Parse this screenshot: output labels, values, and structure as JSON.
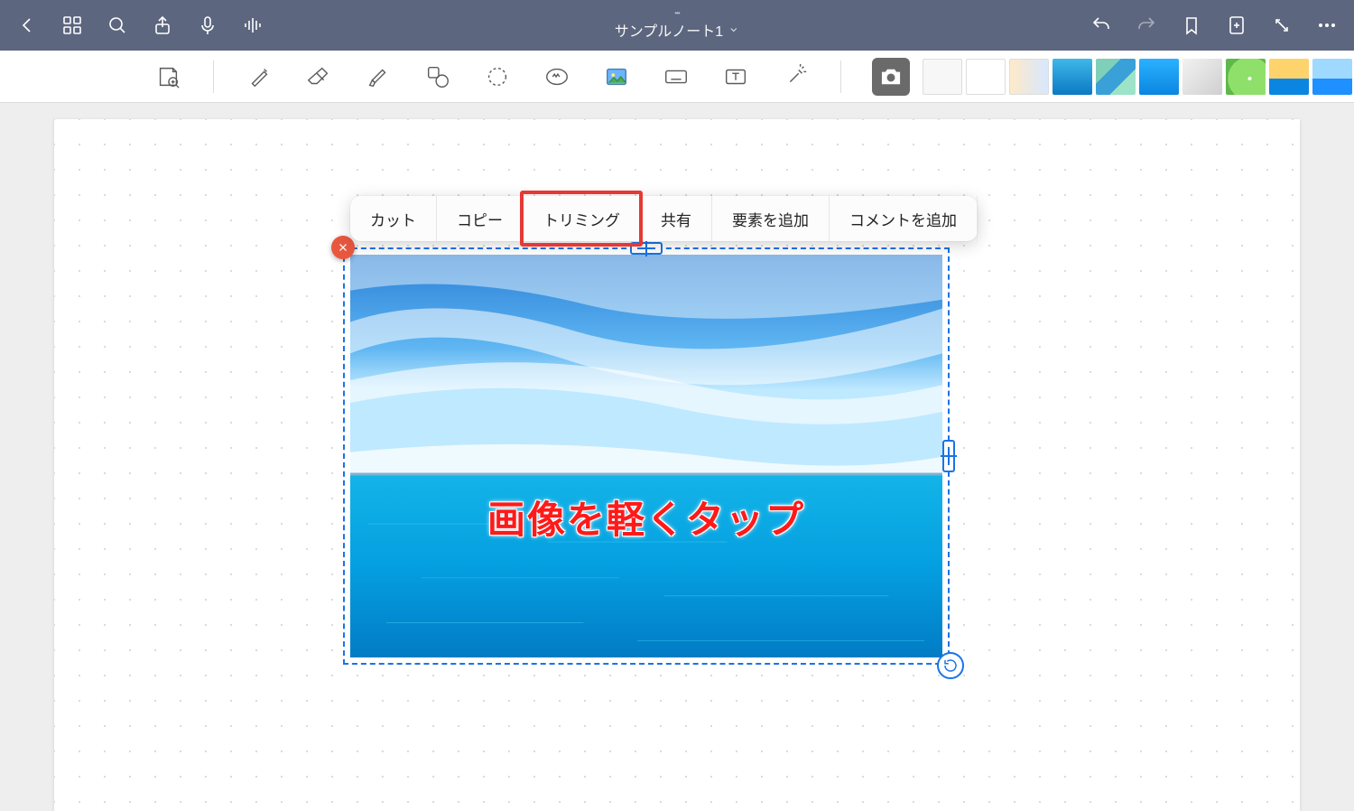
{
  "topbar": {
    "title": "サンプルノート1",
    "ellipsis": "•••"
  },
  "context_menu": {
    "items": [
      "カット",
      "コピー",
      "トリミング",
      "共有",
      "要素を追加",
      "コメントを追加"
    ],
    "highlighted_index": 2
  },
  "image_overlay": {
    "text": "画像を軽くタップ"
  },
  "thumbnails": [
    {
      "bg": "linear-gradient(#f7f7f7,#f7f7f7)",
      "border": "1px solid #ddd"
    },
    {
      "bg": "linear-gradient(#fff,#fff)",
      "border": "1px solid #ddd"
    },
    {
      "bg": "linear-gradient(90deg,#ffe9c8,#d7e8ff)",
      "border": "1px solid #ddd"
    },
    {
      "bg": "linear-gradient(#3fb8e8,#0b79c4)"
    },
    {
      "bg": "linear-gradient(135deg,#7fd0b8 0 33%,#3aa0d8 33% 66%,#9de3c8 66%)"
    },
    {
      "bg": "linear-gradient(#2bb1ff,#0a86e0)"
    },
    {
      "bg": "linear-gradient(135deg,#f2f2f2,#cfcfcf)"
    },
    {
      "bg": "radial-gradient(circle at 60% 55%,#fff 0 6%,#8fe06b 6% 70%,#5fb84a 70%)"
    },
    {
      "bg": "linear-gradient(#ffd36b 0 55%,#0a86e0 55%)"
    },
    {
      "bg": "linear-gradient(#9fd9ff 0 55%,#1e90ff 55%)"
    },
    {
      "bg": "radial-gradient(circle at 30% 30%,#ffe9a0,#e0f3c6)"
    },
    {
      "bg": "linear-gradient(135deg,#f7b6c2,#c39be8)"
    }
  ]
}
